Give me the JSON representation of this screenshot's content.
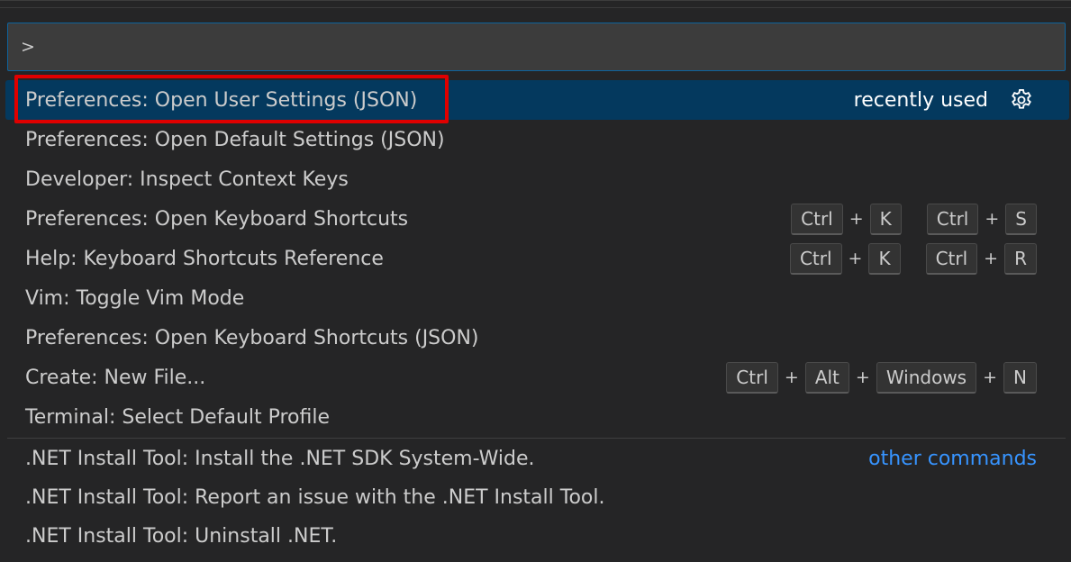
{
  "input": {
    "value": ">"
  },
  "recent_items": [
    {
      "label": "Preferences: Open User Settings (JSON)",
      "recently_used": "recently used",
      "icon": "gear-icon"
    },
    {
      "label": "Preferences: Open Default Settings (JSON)"
    },
    {
      "label": "Developer: Inspect Context Keys"
    },
    {
      "label": "Preferences: Open Keyboard Shortcuts",
      "keys": [
        [
          "Ctrl",
          "K"
        ],
        [
          "Ctrl",
          "S"
        ]
      ]
    },
    {
      "label": "Help: Keyboard Shortcuts Reference",
      "keys": [
        [
          "Ctrl",
          "K"
        ],
        [
          "Ctrl",
          "R"
        ]
      ]
    },
    {
      "label": "Vim: Toggle Vim Mode"
    },
    {
      "label": "Preferences: Open Keyboard Shortcuts (JSON)"
    },
    {
      "label": "Create: New File...",
      "keys": [
        [
          "Ctrl",
          "Alt",
          "Windows",
          "N"
        ]
      ]
    },
    {
      "label": "Terminal: Select Default Profile"
    }
  ],
  "other_section": {
    "link_label": "other commands",
    "items": [
      {
        "label": ".NET Install Tool: Install the .NET SDK System-Wide."
      },
      {
        "label": ".NET Install Tool: Report an issue with the .NET Install Tool."
      },
      {
        "label": ".NET Install Tool: Uninstall .NET."
      }
    ]
  },
  "colors": {
    "background": "#252526",
    "selected_row": "#04395e",
    "highlight_border": "#e00000",
    "link": "#3794ff"
  }
}
